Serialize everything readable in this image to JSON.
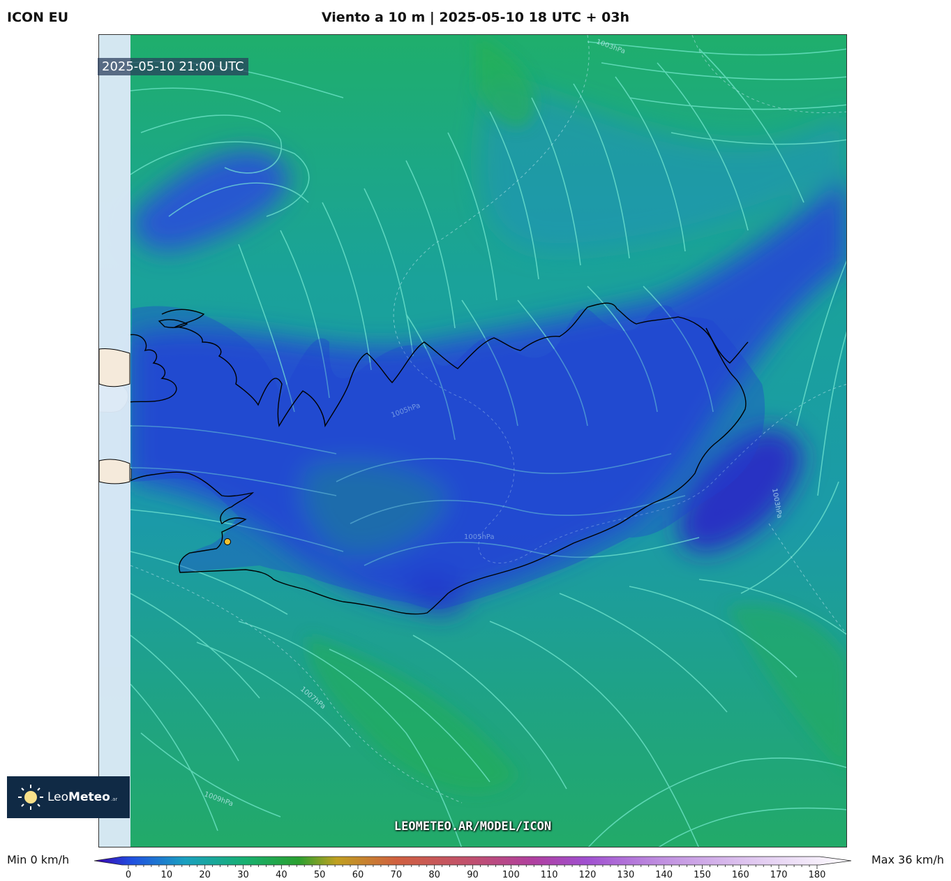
{
  "header": {
    "model": "ICON EU",
    "title": "Viento a 10 m | 2025-05-10 18 UTC + 03h"
  },
  "map": {
    "valid_time": "2025-05-10 21:00 UTC",
    "isobar_labels": [
      "1005hPa",
      "1005hPa",
      "1007hPa",
      "1009hPa",
      "1003hPa",
      "1003hPa"
    ],
    "colors": {
      "sea_high": "#1fb065",
      "sea_mid": "#1aa5a0",
      "calm": "#2440d8",
      "land_outside": "#f5eadb",
      "no_data_strip": "#dce9f7",
      "streamlines": "#7ef0d8",
      "coastline": "#000000",
      "station": "#f2c230"
    }
  },
  "branding": {
    "logo_name_light": "Leo",
    "logo_name_bold": "Meteo",
    "logo_suffix": ".ar",
    "watermark": "LEOMETEO.AR/MODEL/ICON"
  },
  "legend": {
    "min_label": "Min 0 km/h",
    "max_label": "Max 36 km/h",
    "ticks": [
      "0",
      "10",
      "20",
      "30",
      "40",
      "50",
      "60",
      "70",
      "80",
      "90",
      "100",
      "110",
      "120",
      "130",
      "140",
      "150",
      "160",
      "170",
      "180"
    ],
    "stops": [
      "#3a00b0",
      "#2050e0",
      "#1aa0c0",
      "#18b070",
      "#2aa030",
      "#c0a020",
      "#d06040",
      "#c05070",
      "#b040a0",
      "#a050d0",
      "#c090e0",
      "#e0c8f0",
      "#ffffff"
    ]
  }
}
